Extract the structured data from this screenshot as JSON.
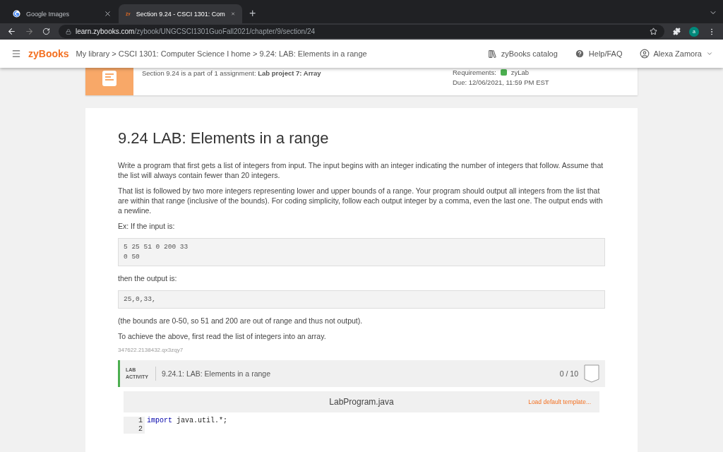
{
  "browser": {
    "tabs": [
      {
        "kind": "google",
        "title": "Google Images",
        "selected": false
      },
      {
        "kind": "zy",
        "title": "Section 9.24 - CSCI 1301: Com",
        "selected": true
      }
    ],
    "new_tab": "+",
    "url_host": "learn.zybooks.com",
    "url_path": "/zybook/UNGCSCI1301GuoFall2021/chapter/9/section/24",
    "profile": "a"
  },
  "header": {
    "logo": "zyBooks",
    "breadcrumb": "My library > CSCI 1301: Computer Science I home > 9.24: LAB: Elements in a range",
    "catalog": "zyBooks catalog",
    "help": "Help/FAQ",
    "user": "Alexa Zamora"
  },
  "assignment": {
    "text": "Section 9.24 is a part of 1 assignment: **Lab project 7: Array**",
    "requirements_label": "Requirements:",
    "requirements": [
      {
        "name": "zyLab",
        "color": "#4caf50"
      }
    ],
    "due": "Due: 12/06/2021, 11:59 PM EST"
  },
  "section": {
    "title": "9.24 LAB: Elements in a range",
    "paragraphs": [
      "Write a program that first gets a list of integers from input. The input begins with an integer indicating the number of integers that follow. Assume that the list will always contain fewer than 20 integers.",
      "That list is followed by two more integers representing lower and upper bounds of a range. Your program should output all integers from the list that are within that range (inclusive of the bounds). For coding simplicity, follow each output integer by a comma, even the last one. The output ends with a newline.",
      "Ex: If the input is:"
    ],
    "input_example": [
      "5 25 51 0 200 33",
      "0 50"
    ],
    "then_text": "then the output is:",
    "output_example": [
      "25,0,33,"
    ],
    "after": [
      "(the bounds are 0-50, so 51 and 200 are out of range and thus not output).",
      "To achieve the above, first read the list of integers into an array."
    ],
    "id_code": "347622.2138432.qx3zqy7"
  },
  "lab": {
    "label_line1": "LAB",
    "label_line2": "ACTIVITY",
    "title": "9.24.1: LAB: Elements in a range",
    "score": "0 / 10",
    "completed": false,
    "file": "LabProgram.java",
    "load_template": "Load default template...",
    "code": [
      {
        "number": "1",
        "keyword": "import",
        "rest": " java.util.*;"
      },
      {
        "number": "2"
      }
    ]
  }
}
